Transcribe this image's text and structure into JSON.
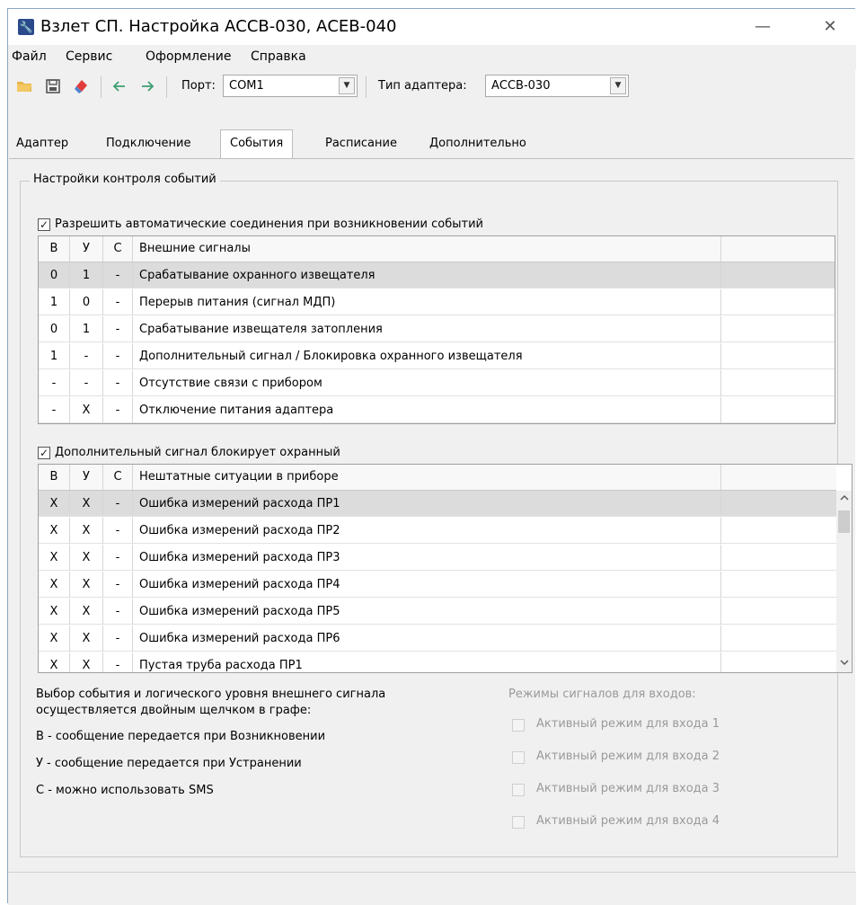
{
  "window": {
    "title": "Взлет СП. Настройка АССВ-030, АСЕВ-040",
    "minimize": "—",
    "close": "✕"
  },
  "menu": [
    "Файл",
    "Сервис",
    "Оформление",
    "Справка"
  ],
  "toolbar": {
    "port_label": "Порт:",
    "port_value": "COM1",
    "adapter_label": "Тип адаптера:",
    "adapter_value": "АССВ-030"
  },
  "tabs": [
    "Адаптер",
    "Подключение",
    "События",
    "Расписание",
    "Дополнительно"
  ],
  "active_tab": "События",
  "group": {
    "title": "Настройки контроля событий",
    "auto_connect_label": "Разрешить автоматические соединения при возникновении событий",
    "extra_blocks_label": "Дополнительный сигнал блокирует охранный"
  },
  "table_external": {
    "headers": [
      "В",
      "У",
      "С",
      "Внешние сигналы"
    ],
    "rows": [
      {
        "b": "0",
        "u": "1",
        "c": "-",
        "name": "Срабатывание охранного извещателя"
      },
      {
        "b": "1",
        "u": "0",
        "c": "-",
        "name": "Перерыв питания (сигнал МДП)"
      },
      {
        "b": "0",
        "u": "1",
        "c": "-",
        "name": "Срабатывание извещателя затопления"
      },
      {
        "b": "1",
        "u": "-",
        "c": "-",
        "name": "Дополнительный сигнал / Блокировка охранного извещателя"
      },
      {
        "b": "-",
        "u": "-",
        "c": "-",
        "name": "Отсутствие связи с прибором"
      },
      {
        "b": "-",
        "u": "X",
        "c": "-",
        "name": "Отключение питания адаптера"
      }
    ]
  },
  "table_device": {
    "headers": [
      "В",
      "У",
      "С",
      "Нештатные ситуации в приборе"
    ],
    "rows": [
      {
        "b": "X",
        "u": "X",
        "c": "-",
        "name": "Ошибка измерений расхода ПР1"
      },
      {
        "b": "X",
        "u": "X",
        "c": "-",
        "name": "Ошибка измерений расхода ПР2"
      },
      {
        "b": "X",
        "u": "X",
        "c": "-",
        "name": "Ошибка измерений расхода ПР3"
      },
      {
        "b": "X",
        "u": "X",
        "c": "-",
        "name": "Ошибка измерений расхода ПР4"
      },
      {
        "b": "X",
        "u": "X",
        "c": "-",
        "name": "Ошибка измерений расхода ПР5"
      },
      {
        "b": "X",
        "u": "X",
        "c": "-",
        "name": "Ошибка измерений расхода ПР6"
      },
      {
        "b": "X",
        "u": "X",
        "c": "-",
        "name": "Пустая труба расхода ПР1"
      }
    ]
  },
  "notes": {
    "line1": "Выбор события и логического уровня внешнего сигнала",
    "line2": "осуществляется двойным щелчком в графе:",
    "b": "В - сообщение передается при Возникновении",
    "u": "У - сообщение передается при Устранении",
    "c": "С - можно использовать SMS"
  },
  "modes": {
    "title": "Режимы сигналов для входов:",
    "items": [
      "Активный режим для входа 1",
      "Активный режим для входа 2",
      "Активный режим для входа 3",
      "Активный режим для входа 4"
    ]
  },
  "colors": {
    "selected_row": "#dcdcdc",
    "accent_icon": "#2b4a8c"
  }
}
